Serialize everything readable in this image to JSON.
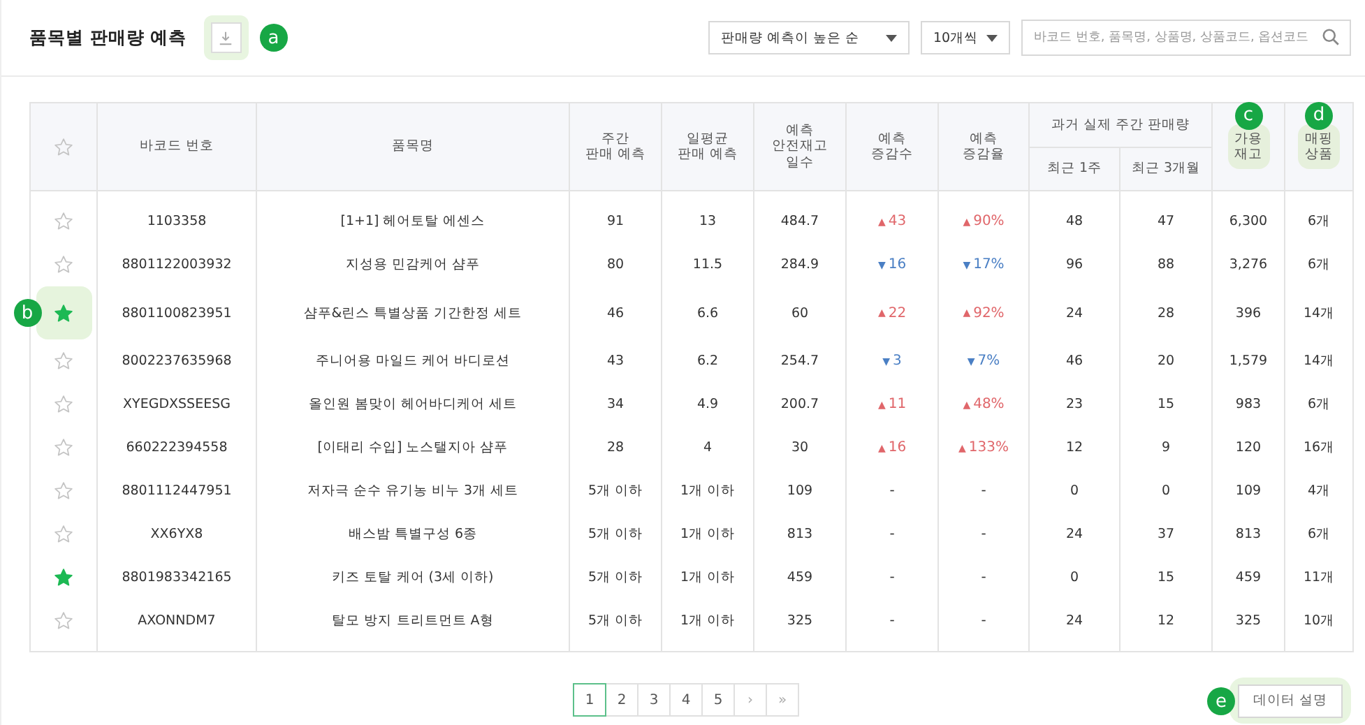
{
  "header": {
    "title": "품목별 판매량 예측",
    "download": {
      "callout": "a"
    },
    "sort": {
      "value": "판매량 예측이 높은 순"
    },
    "page_size": {
      "value": "10개씩"
    },
    "search": {
      "placeholder": "바코드 번호, 품목명, 상품명, 상품코드, 옵션코드"
    }
  },
  "table": {
    "columns": [
      {
        "kind": "plain",
        "label": "바코드 번호"
      },
      {
        "kind": "plain",
        "label": "품목명"
      },
      {
        "kind": "plain",
        "label": "주간\n판매 예측"
      },
      {
        "kind": "plain",
        "label": "일평균\n판매 예측"
      },
      {
        "kind": "plain",
        "label": "예측\n안전재고\n일수"
      },
      {
        "kind": "plain",
        "label": "예측\n증감수"
      },
      {
        "kind": "plain",
        "label": "예측\n증감율"
      },
      {
        "kind": "group",
        "label": "과거 실제 주간 판매량",
        "children": [
          "최근 1주",
          "최근 3개월"
        ]
      },
      {
        "kind": "plain",
        "label": "가용\n재고",
        "callout": "c"
      },
      {
        "kind": "plain",
        "label": "매핑\n상품",
        "callout": "d"
      }
    ],
    "rows": [
      {
        "starred": false,
        "barcode": "1103358",
        "name": "[1+1] 헤어토탈 에센스",
        "weekly": "91",
        "daily": "13",
        "safety_days": "484.7",
        "change_count": {
          "arrow": "▲",
          "color": "#e0666a",
          "text": "43"
        },
        "change_rate": {
          "arrow": "▲",
          "color": "#e0666a",
          "text": "90%"
        },
        "last_week": "48",
        "last_3m": "47",
        "stock": "6,300",
        "mapped": "6개"
      },
      {
        "starred": false,
        "barcode": "8801122003932",
        "name": "지성용 민감케어 샴푸",
        "weekly": "80",
        "daily": "11.5",
        "safety_days": "284.9",
        "change_count": {
          "arrow": "▼",
          "color": "#4a7fc4",
          "text": "16"
        },
        "change_rate": {
          "arrow": "▼",
          "color": "#4a7fc4",
          "text": "17%"
        },
        "last_week": "96",
        "last_3m": "88",
        "stock": "3,276",
        "mapped": "6개"
      },
      {
        "starred": true,
        "callout": "b",
        "barcode": "8801100823951",
        "name": "샴푸&린스 특별상품 기간한정 세트",
        "weekly": "46",
        "daily": "6.6",
        "safety_days": "60",
        "change_count": {
          "arrow": "▲",
          "color": "#e0666a",
          "text": "22"
        },
        "change_rate": {
          "arrow": "▲",
          "color": "#e0666a",
          "text": "92%"
        },
        "last_week": "24",
        "last_3m": "28",
        "stock": "396",
        "mapped": "14개"
      },
      {
        "starred": false,
        "barcode": "8002237635968",
        "name": "주니어용 마일드 케어 바디로션",
        "weekly": "43",
        "daily": "6.2",
        "safety_days": "254.7",
        "change_count": {
          "arrow": "▼",
          "color": "#4a7fc4",
          "text": "3"
        },
        "change_rate": {
          "arrow": "▼",
          "color": "#4a7fc4",
          "text": "7%"
        },
        "last_week": "46",
        "last_3m": "20",
        "stock": "1,579",
        "mapped": "14개"
      },
      {
        "starred": false,
        "barcode": "XYEGDXSSEESG",
        "name": "올인원 봄맞이 헤어바디케어 세트",
        "weekly": "34",
        "daily": "4.9",
        "safety_days": "200.7",
        "change_count": {
          "arrow": "▲",
          "color": "#e0666a",
          "text": "11"
        },
        "change_rate": {
          "arrow": "▲",
          "color": "#e0666a",
          "text": "48%"
        },
        "last_week": "23",
        "last_3m": "15",
        "stock": "983",
        "mapped": "6개"
      },
      {
        "starred": false,
        "barcode": "660222394558",
        "name": "[이태리 수입] 노스탤지아 샴푸",
        "weekly": "28",
        "daily": "4",
        "safety_days": "30",
        "change_count": {
          "arrow": "▲",
          "color": "#e0666a",
          "text": "16"
        },
        "change_rate": {
          "arrow": "▲",
          "color": "#e0666a",
          "text": "133%"
        },
        "last_week": "12",
        "last_3m": "9",
        "stock": "120",
        "mapped": "16개"
      },
      {
        "starred": false,
        "barcode": "8801112447951",
        "name": "저자극 순수 유기농 비누 3개 세트",
        "weekly": "5개 이하",
        "daily": "1개 이하",
        "safety_days": "109",
        "change_count": {
          "text": "-"
        },
        "change_rate": {
          "text": "-"
        },
        "last_week": "0",
        "last_3m": "0",
        "stock": "109",
        "mapped": "4개"
      },
      {
        "starred": false,
        "barcode": "XX6YX8",
        "name": "배스밤 특별구성 6종",
        "weekly": "5개 이하",
        "daily": "1개 이하",
        "safety_days": "813",
        "change_count": {
          "text": "-"
        },
        "change_rate": {
          "text": "-"
        },
        "last_week": "24",
        "last_3m": "37",
        "stock": "813",
        "mapped": "6개"
      },
      {
        "starred": true,
        "barcode": "8801983342165",
        "name": "키즈 토탈 케어 (3세 이하)",
        "weekly": "5개 이하",
        "daily": "1개 이하",
        "safety_days": "459",
        "change_count": {
          "text": "-"
        },
        "change_rate": {
          "text": "-"
        },
        "last_week": "0",
        "last_3m": "15",
        "stock": "459",
        "mapped": "11개"
      },
      {
        "starred": false,
        "barcode": "AXONNDM7",
        "name": "탈모 방지 트리트먼트 A형",
        "weekly": "5개 이하",
        "daily": "1개 이하",
        "safety_days": "325",
        "change_count": {
          "text": "-"
        },
        "change_rate": {
          "text": "-"
        },
        "last_week": "24",
        "last_3m": "12",
        "stock": "325",
        "mapped": "10개"
      }
    ]
  },
  "pagination": {
    "pages": [
      {
        "label": "1",
        "selected": true
      },
      {
        "label": "2",
        "selected": false
      },
      {
        "label": "3",
        "selected": false
      },
      {
        "label": "4",
        "selected": false
      },
      {
        "label": "5",
        "selected": false
      }
    ],
    "next": "›",
    "last": "»"
  },
  "help_button": {
    "label": "데이터 설명",
    "callout": "e"
  }
}
